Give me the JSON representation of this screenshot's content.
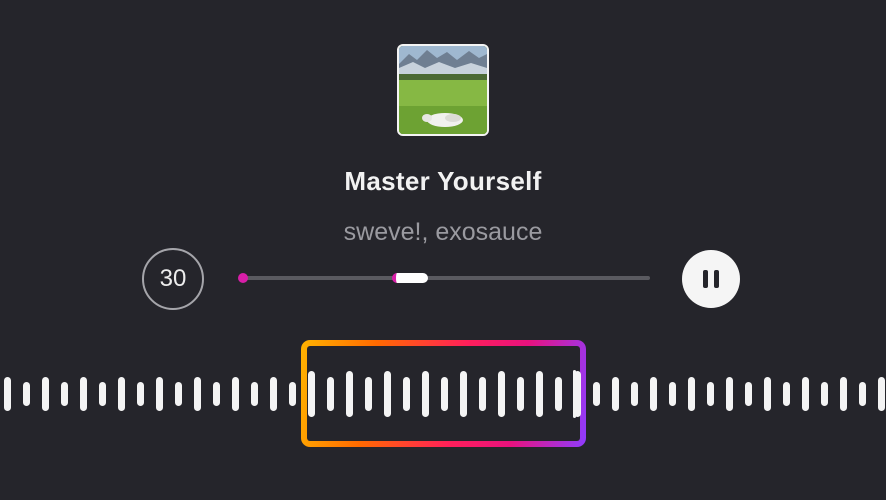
{
  "track": {
    "title": "Master Yourself",
    "artist": "sweve!, exosauce"
  },
  "controls": {
    "skip_label": "30",
    "skip_icon": "skip-30-icon",
    "pause_icon": "pause-icon"
  },
  "colors": {
    "background": "#25252b",
    "accent": "#d81ea8",
    "frame_gradient": [
      "#ffb300",
      "#ff6a00",
      "#ff1f5a",
      "#e8127e",
      "#8f3cff"
    ]
  }
}
